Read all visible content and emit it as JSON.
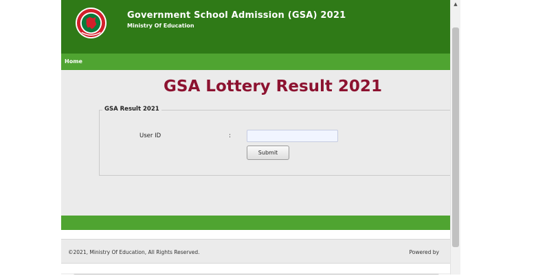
{
  "header": {
    "title": "Government School Admission (GSA) 2021",
    "subtitle": "Ministry Of Education",
    "logo_icon": "bangladesh-government-seal",
    "bg_color": "#2f7a17"
  },
  "nav": {
    "home_label": "Home",
    "bg_color": "#4fa431"
  },
  "main": {
    "heading": "GSA Lottery Result 2021",
    "heading_color": "#8c1230",
    "form": {
      "legend": "GSA Result 2021",
      "user_id_label": "User ID",
      "colon": ":",
      "user_id_value": "",
      "submit_label": "Submit"
    }
  },
  "footer": {
    "copyright": "©2021, Ministry Of Education, All Rights Reserved.",
    "powered_by": "Powered by"
  },
  "scrollbar": {
    "up_arrow_icon": "chevron-up-icon"
  }
}
